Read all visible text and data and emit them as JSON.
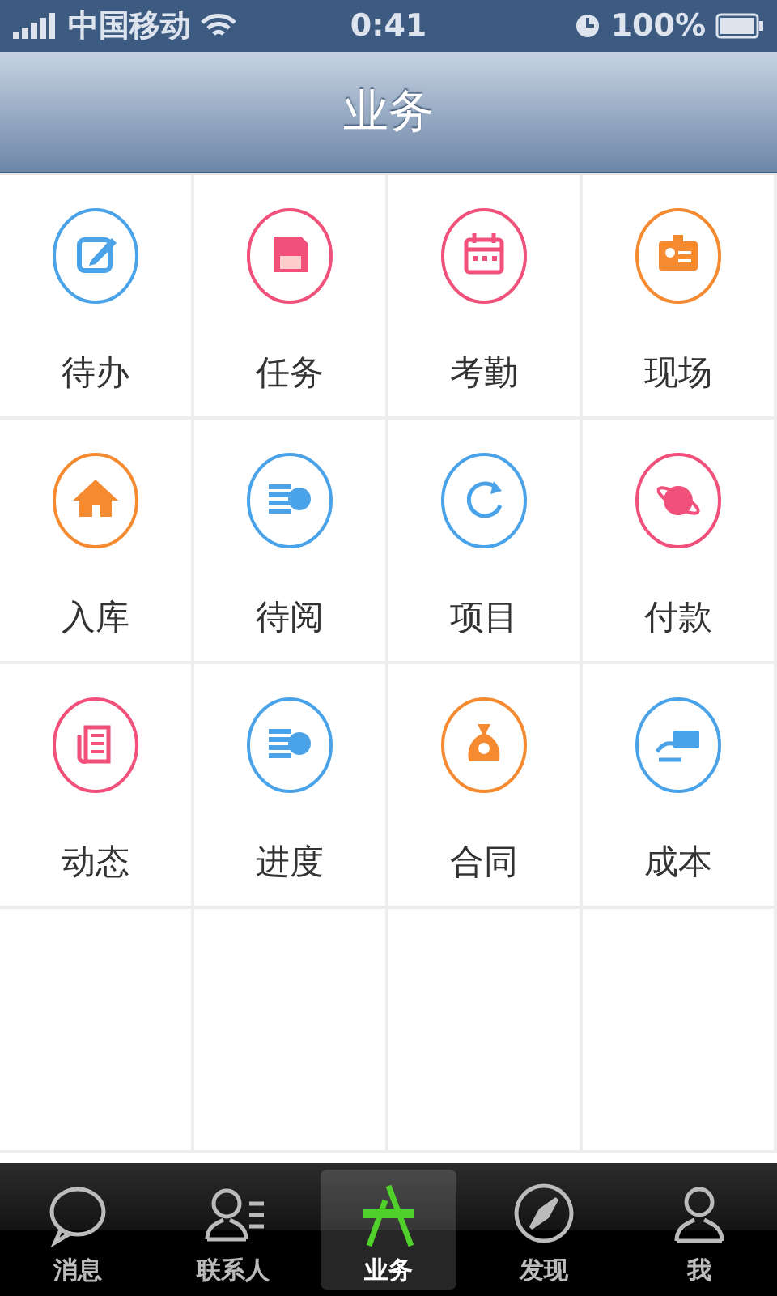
{
  "status_bar": {
    "carrier": "中国移动",
    "time": "0:41",
    "battery": "100%"
  },
  "nav_bar": {
    "title": "业务"
  },
  "grid": [
    {
      "label": "待办",
      "color": "#4aa3e8"
    },
    {
      "label": "任务",
      "color": "#f0507a"
    },
    {
      "label": "考勤",
      "color": "#f0507a"
    },
    {
      "label": "现场",
      "color": "#f58a30"
    },
    {
      "label": "入库",
      "color": "#f58a30"
    },
    {
      "label": "待阅",
      "color": "#4aa3e8"
    },
    {
      "label": "项目",
      "color": "#4aa3e8"
    },
    {
      "label": "付款",
      "color": "#f0507a"
    },
    {
      "label": "动态",
      "color": "#f0507a"
    },
    {
      "label": "进度",
      "color": "#4aa3e8"
    },
    {
      "label": "合同",
      "color": "#f58a30"
    },
    {
      "label": "成本",
      "color": "#4aa3e8"
    }
  ],
  "tab_bar": [
    {
      "label": "消息",
      "selected": false
    },
    {
      "label": "联系人",
      "selected": false
    },
    {
      "label": "业务",
      "selected": true
    },
    {
      "label": "发现",
      "selected": false
    },
    {
      "label": "我",
      "selected": false
    }
  ]
}
